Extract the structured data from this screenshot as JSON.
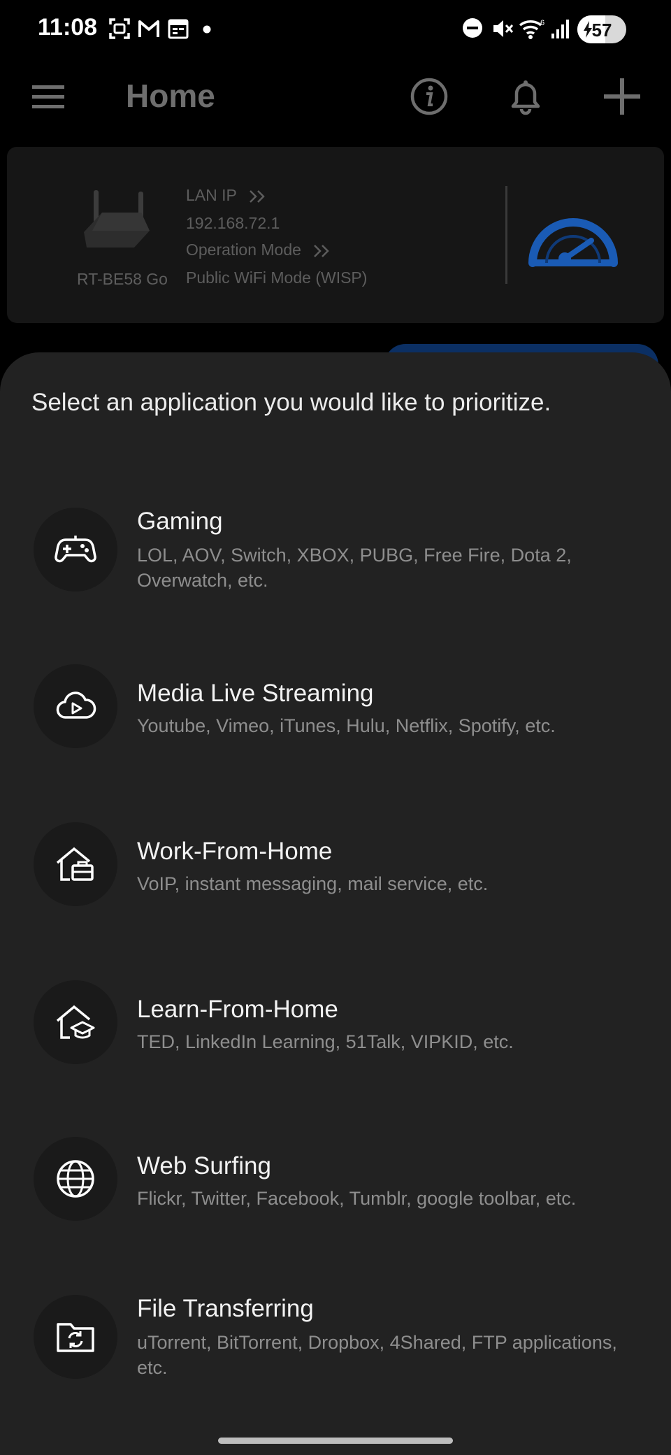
{
  "status_bar": {
    "time": "11:08",
    "battery": "57",
    "battery_level": 0.57,
    "icons": [
      "screenshot-icon",
      "gmail-icon",
      "calendar-icon",
      "notification-dot-icon",
      "dnd-icon",
      "mute-icon",
      "wifi-icon",
      "signal-icon",
      "battery-icon"
    ]
  },
  "app_bar": {
    "title": "Home",
    "icons": [
      "menu-icon",
      "info-icon",
      "bell-icon",
      "add-icon"
    ]
  },
  "device": {
    "name": "RT-BE58 Go",
    "lan_ip_label": "LAN IP",
    "lan_ip_value": "192.168.72.1",
    "operation_mode_label": "Operation Mode",
    "operation_mode_value": "Public WiFi Mode (WISP)",
    "accent": "#1a5bb5"
  },
  "sheet": {
    "title": "Select an application you would like to prioritize.",
    "items": [
      {
        "name": "Gaming",
        "desc": "LOL, AOV, Switch, XBOX, PUBG, Free Fire, Dota 2, Overwatch, etc.",
        "icon": "gamepad-icon"
      },
      {
        "name": "Media Live Streaming",
        "desc": "Youtube, Vimeo, iTunes, Hulu, Netflix, Spotify, etc.",
        "icon": "cloud-play-icon"
      },
      {
        "name": "Work-From-Home",
        "desc": "VoIP, instant messaging, mail service, etc.",
        "icon": "home-briefcase-icon"
      },
      {
        "name": "Learn-From-Home",
        "desc": "TED, LinkedIn Learning, 51Talk, VIPKID, etc.",
        "icon": "home-graduation-icon"
      },
      {
        "name": "Web Surfing",
        "desc": "Flickr, Twitter, Facebook, Tumblr, google toolbar, etc.",
        "icon": "globe-icon"
      },
      {
        "name": "File Transferring",
        "desc": "uTorrent, BitTorrent, Dropbox, 4Shared, FTP applications, etc.",
        "icon": "folder-sync-icon"
      }
    ]
  },
  "colors": {
    "background": "#000000",
    "sheet": "#222222",
    "icon_circle": "#1a1a1a",
    "muted_text": "#8e8e8e"
  }
}
